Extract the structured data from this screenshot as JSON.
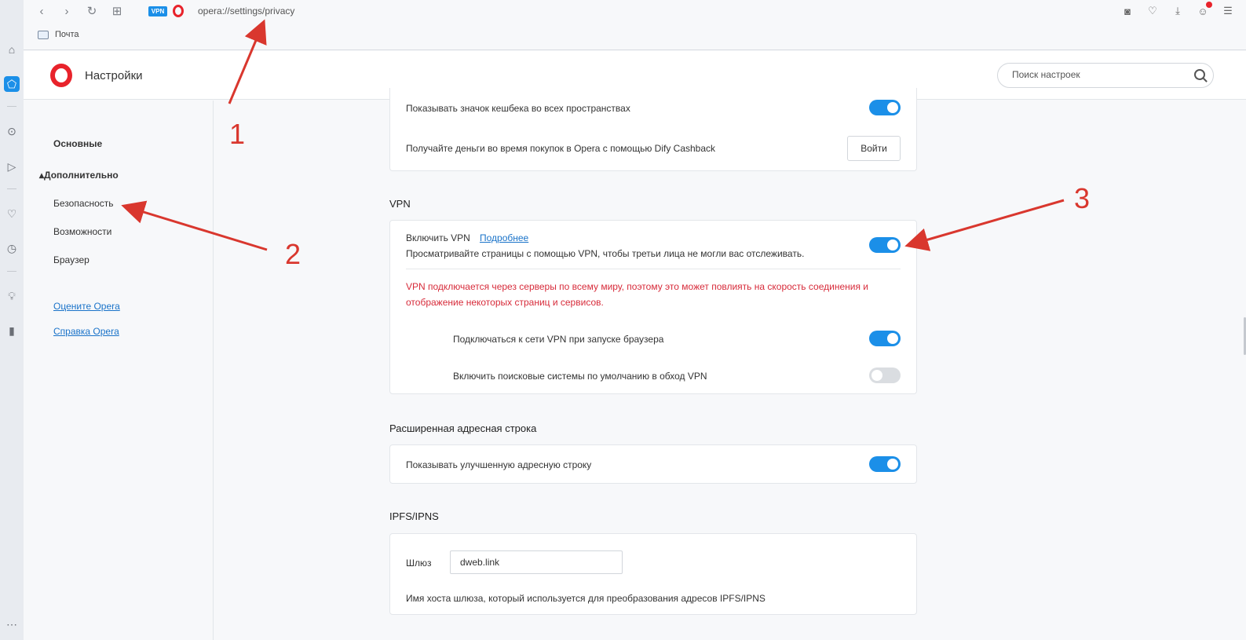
{
  "topbar": {
    "vpn_badge": "VPN",
    "url": "opera://settings/privacy",
    "bookmark_label": "Почта"
  },
  "header": {
    "title": "Настройки",
    "search_placeholder": "Поиск настроек"
  },
  "nav": {
    "basic": "Основные",
    "advanced": "▴Дополнительно",
    "security": "Безопасность",
    "features": "Возможности",
    "browser": "Браузер",
    "rate": "Оцените Opera",
    "help": "Справка Opera"
  },
  "cashback": {
    "show_icon": "Показывать значок кешбека во всех пространствах",
    "show_icon_on": true,
    "earn": "Получайте деньги во время покупок в Opera с помощью Dify Cashback",
    "login_btn": "Войти"
  },
  "vpn": {
    "section": "VPN",
    "enable_label": "Включить VPN",
    "more_link": "Подробнее",
    "description": "Просматривайте страницы с помощью VPN, чтобы третьи лица не могли вас отслеживать.",
    "enabled": true,
    "warning_line1": "VPN подключается через серверы по всему миру, поэтому это может повлиять на скорость соединения и",
    "warning_line2": "отображение некоторых страниц и сервисов.",
    "connect_on_start": "Подключаться к сети VPN при запуске браузера",
    "connect_on_start_on": true,
    "bypass_search": "Включить поисковые системы по умолчанию в обход VPN",
    "bypass_search_on": false
  },
  "addressbar": {
    "section": "Расширенная адресная строка",
    "show_improved": "Показывать улучшенную адресную строку",
    "show_improved_on": true
  },
  "ipfs": {
    "section": "IPFS/IPNS",
    "gateway_label": "Шлюз",
    "gateway_value": "dweb.link",
    "gateway_hint": "Имя хоста шлюза, который используется для преобразования адресов IPFS/IPNS"
  },
  "annotations": {
    "n1": "1",
    "n2": "2",
    "n3": "3",
    "color": "#d9372e"
  },
  "colors": {
    "accent": "#1b8fe8",
    "opera_red": "#e8232b",
    "warning": "#d72b3a"
  }
}
